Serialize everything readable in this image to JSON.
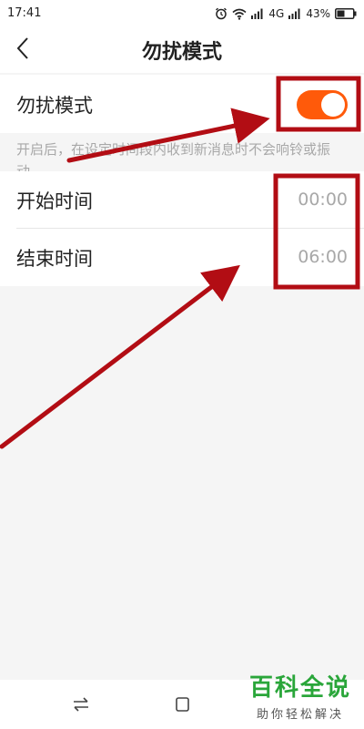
{
  "status_bar": {
    "time": "17:41",
    "network": "4G",
    "battery": "43%"
  },
  "header": {
    "title": "勿扰模式"
  },
  "dnd": {
    "label": "勿扰模式",
    "enabled": true,
    "description": "开启后，在设定时间段内收到新消息时不会响铃或振动。"
  },
  "schedule": {
    "start_label": "开始时间",
    "start_value": "00:00",
    "end_label": "结束时间",
    "end_value": "06:00"
  },
  "watermark": {
    "title": "百科全说",
    "subtitle": "助你轻松解决"
  },
  "colors": {
    "toggle_on": "#ff5a0a",
    "annotation_red": "#b20d14",
    "watermark_green": "#2aa63a"
  }
}
